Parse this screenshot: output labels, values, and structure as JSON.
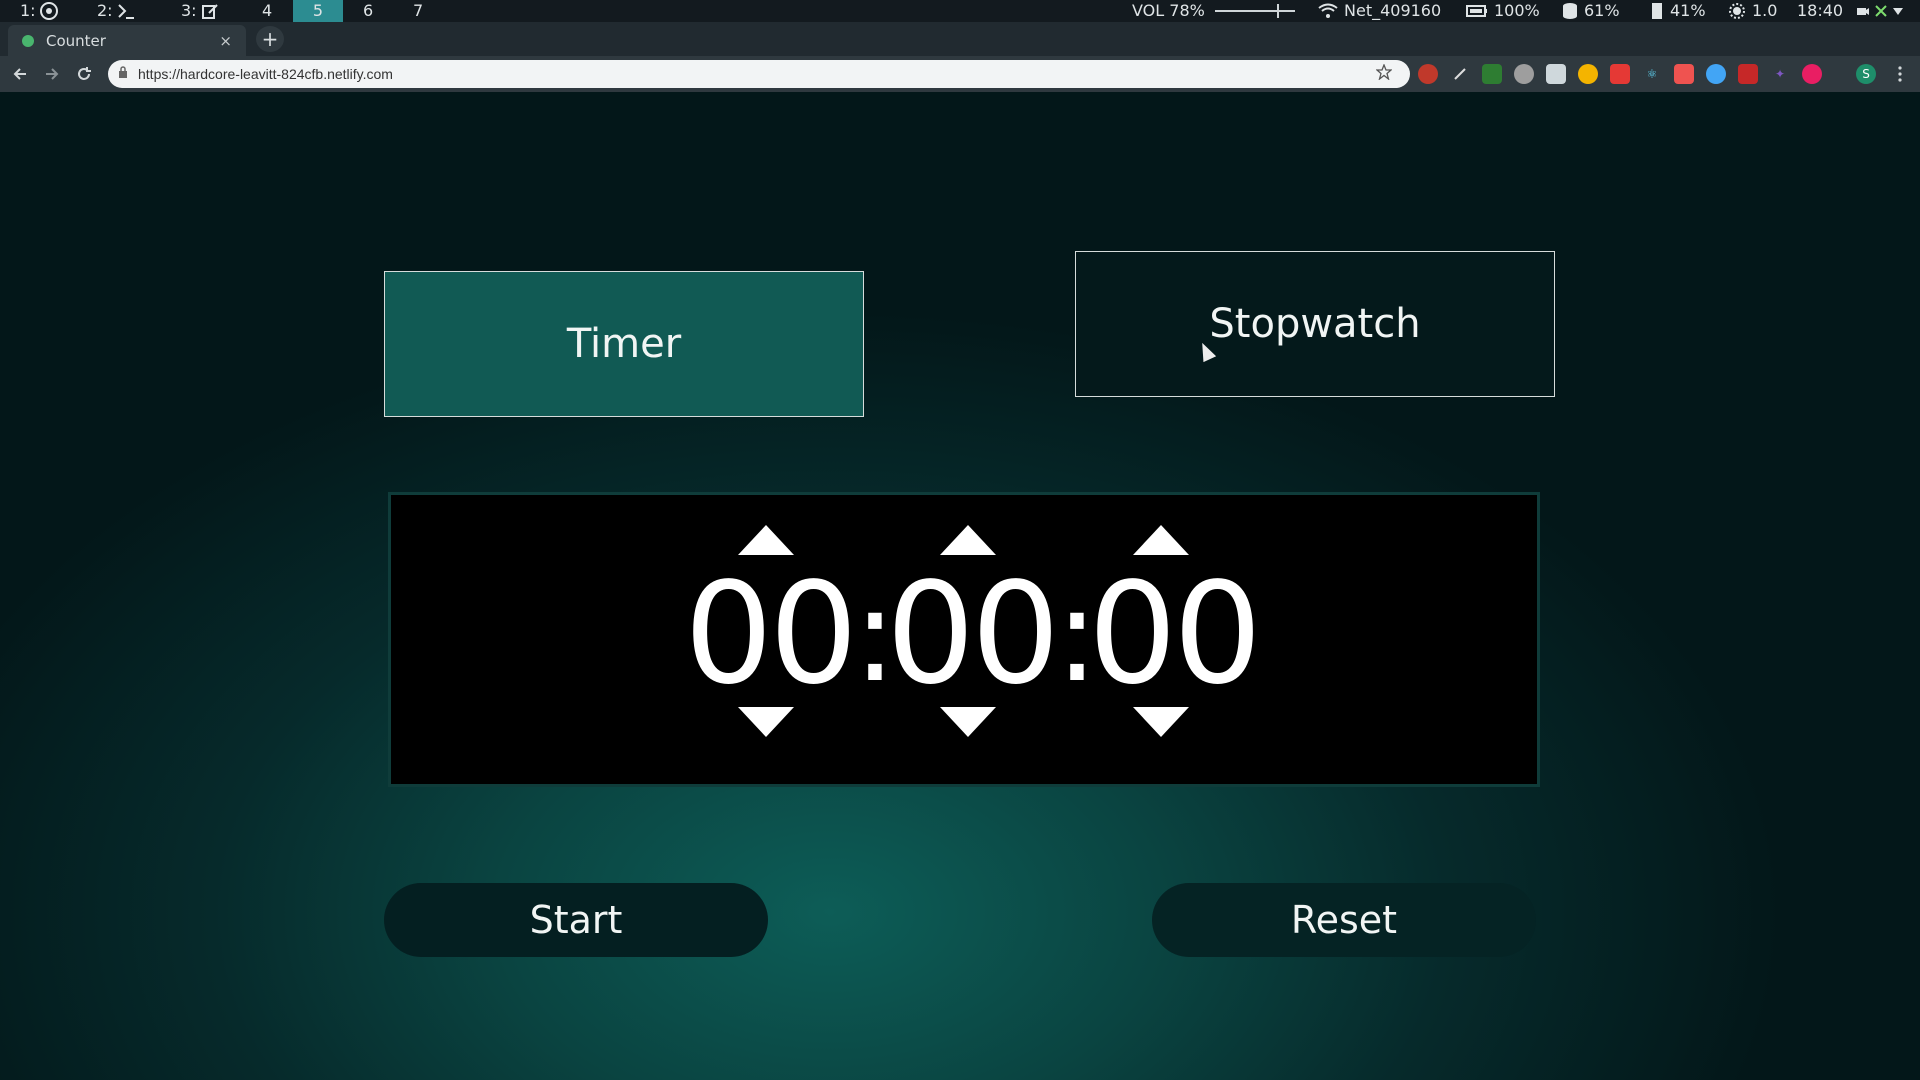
{
  "system_bar": {
    "workspaces": [
      {
        "label": "1:",
        "icon": "chrome-icon"
      },
      {
        "label": "2:",
        "icon": "terminal-icon"
      },
      {
        "label": "3:",
        "icon": "edit-icon"
      },
      {
        "label": "4"
      },
      {
        "label": "5",
        "active": true
      },
      {
        "label": "6"
      },
      {
        "label": "7"
      }
    ],
    "volume": "VOL 78%",
    "network": "Net_409160",
    "battery": "100%",
    "disk": "61%",
    "memory": "41%",
    "brightness": "1.0",
    "clock": "18:40"
  },
  "browser": {
    "tab_title": "Counter",
    "tab_close": "×",
    "new_tab": "+",
    "url": "https://hardcore-leavitt-824cfb.netlify.com",
    "profile_initial": "S"
  },
  "app": {
    "mode_timer": "Timer",
    "mode_stopwatch": "Stopwatch",
    "hours": "00",
    "minutes": "00",
    "seconds": "00",
    "separator": ":",
    "start_label": "Start",
    "reset_label": "Reset"
  },
  "colors": {
    "accent": "#115a54",
    "display_bg": "#000000",
    "text": "#f1f5f4"
  }
}
